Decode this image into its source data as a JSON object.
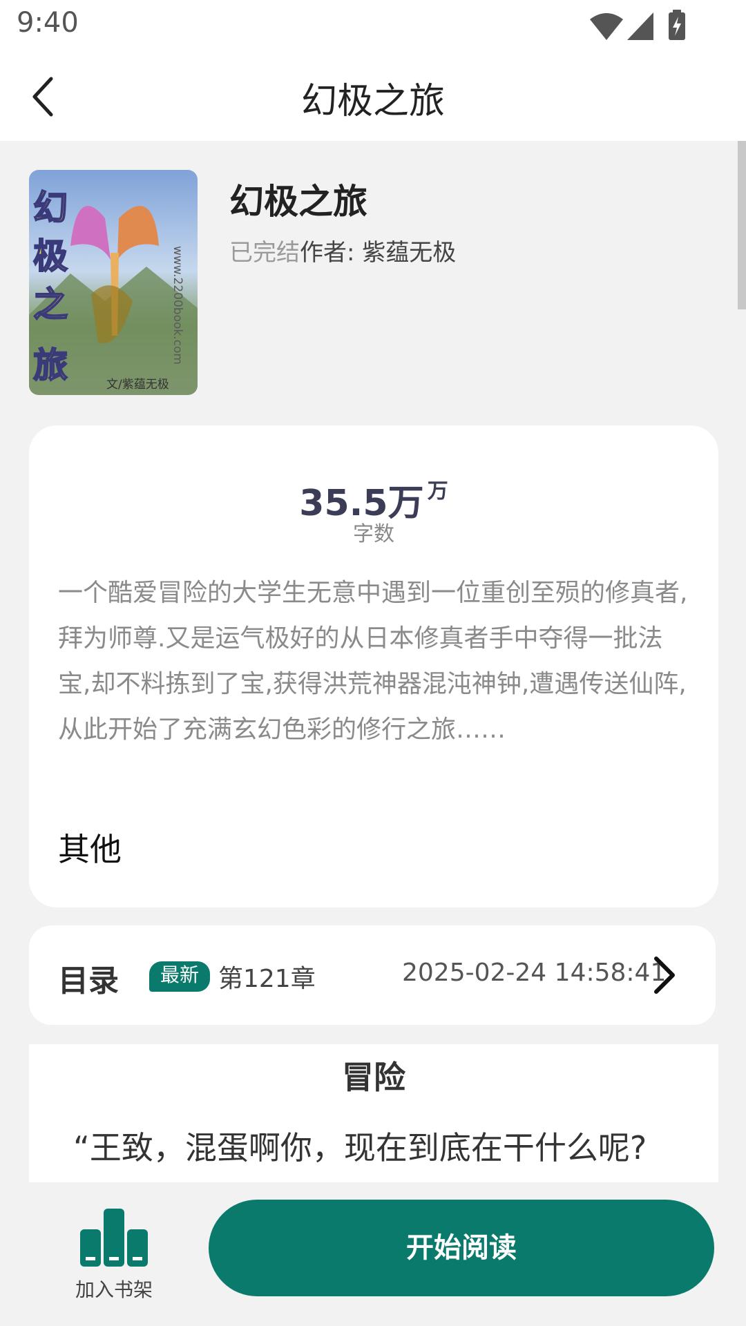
{
  "status_bar": {
    "time": "9:40"
  },
  "header": {
    "title": "幻极之旅"
  },
  "book": {
    "title": "幻极之旅",
    "status": "已完结",
    "author": "作者: 紫蕴无极",
    "cover_text": "幻极之旅",
    "cover_site": "www.2200book.com",
    "cover_byline": "文/紫蕴无极"
  },
  "info": {
    "word_count": "35.5万",
    "word_count_unit": "万",
    "word_count_label": "字数",
    "synopsis": "一个酷爱冒险的大学生无意中遇到一位重创至殒的修真者,拜为师尊.又是运气极好的从日本修真者手中夺得一批法宝,却不料拣到了宝,获得洪荒神器混沌神钟,遭遇传送仙阵,从此开始了充满玄幻色彩的修行之旅……",
    "category": "其他"
  },
  "toc": {
    "label": "目录",
    "badge": "最新",
    "latest_chapter": "第121章",
    "updated": "2025-02-24 14:58:41"
  },
  "preview": {
    "title": "冒险",
    "first_line": "“王致，混蛋啊你，现在到底在干什么呢?"
  },
  "bottom": {
    "shelf_label": "加入书架",
    "read_label": "开始阅读"
  },
  "colors": {
    "accent": "#0a7a6c",
    "background": "#f2f2f2"
  }
}
